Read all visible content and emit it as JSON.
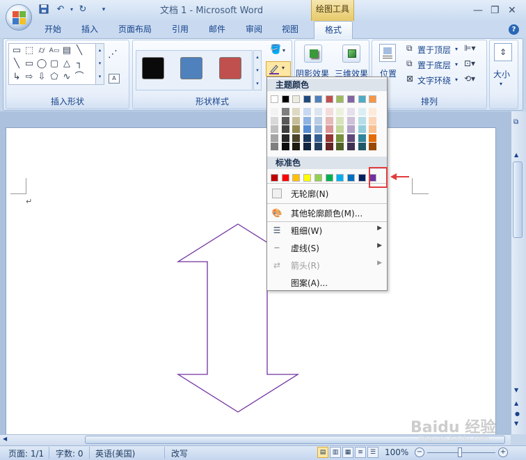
{
  "window": {
    "title": "文档 1 - Microsoft Word",
    "contextual_tab_group": "绘图工具"
  },
  "tabs": [
    "开始",
    "插入",
    "页面布局",
    "引用",
    "邮件",
    "审阅",
    "视图"
  ],
  "active_tab": "格式",
  "ribbon": {
    "groups": [
      {
        "label": "插入形状"
      },
      {
        "label": "形状样式"
      },
      {
        "label": "排列"
      }
    ],
    "shape_styles": [
      "#0a0a0a",
      "#4f81bd",
      "#c0504d"
    ],
    "effects": {
      "shadow_label": "阴影效果",
      "threed_label": "三维效果"
    },
    "arrange": {
      "position_label": "位置",
      "bring_front_label": "置于顶层",
      "send_back_label": "置于底层",
      "text_wrap_label": "文字环绕",
      "size_label": "大小"
    }
  },
  "outline_menu": {
    "theme_colors_header": "主题颜色",
    "standard_colors_header": "标准色",
    "theme_top_row": [
      "#ffffff",
      "#000000",
      "#eeece1",
      "#1f497d",
      "#4f81bd",
      "#c0504d",
      "#9bbb59",
      "#8064a2",
      "#4bacc6",
      "#f79646"
    ],
    "theme_shades": [
      [
        "#f2f2f2",
        "#7f7f7f",
        "#ddd9c3",
        "#c6d9f0",
        "#dbe5f1",
        "#f2dcdb",
        "#ebf1dd",
        "#e5e0ec",
        "#dbeef3",
        "#fdeada"
      ],
      [
        "#d8d8d8",
        "#595959",
        "#c4bd97",
        "#8db3e2",
        "#b8cce4",
        "#e5b9b7",
        "#d7e3bc",
        "#ccc1d9",
        "#b7dde8",
        "#fbd5b5"
      ],
      [
        "#bfbfbf",
        "#3f3f3f",
        "#938953",
        "#548dd4",
        "#95b3d7",
        "#d99694",
        "#c3d69b",
        "#b2a2c7",
        "#92cddc",
        "#fac08f"
      ],
      [
        "#a5a5a5",
        "#262626",
        "#494429",
        "#17365d",
        "#366092",
        "#953734",
        "#76923c",
        "#5f497a",
        "#31859b",
        "#e36c09"
      ],
      [
        "#7f7f7f",
        "#0c0c0c",
        "#1d1b10",
        "#0f243e",
        "#244061",
        "#632423",
        "#4f6128",
        "#3f3151",
        "#205867",
        "#974806"
      ]
    ],
    "standard_colors": [
      "#c00000",
      "#ff0000",
      "#ffc000",
      "#ffff00",
      "#92d050",
      "#00b050",
      "#00b0f0",
      "#0070c0",
      "#002060",
      "#7030a0"
    ],
    "items": [
      {
        "label": "无轮廓(N)",
        "has_submenu": false,
        "disabled": false
      },
      {
        "label": "其他轮廓颜色(M)...",
        "has_submenu": false,
        "disabled": false
      },
      {
        "label": "粗细(W)",
        "has_submenu": true,
        "disabled": false
      },
      {
        "label": "虚线(S)",
        "has_submenu": true,
        "disabled": false
      },
      {
        "label": "箭头(R)",
        "has_submenu": true,
        "disabled": true
      },
      {
        "label": "图案(A)...",
        "has_submenu": false,
        "disabled": false
      }
    ]
  },
  "document": {
    "shape_outline_color": "#7030a0"
  },
  "status_bar": {
    "page": "页面: 1/1",
    "words": "字数: 0",
    "language": "英语(美国)",
    "mode": "改写",
    "zoom": "100%"
  },
  "watermark": "Baidu 经验",
  "watermark_url": "jingyan.baidu.com"
}
